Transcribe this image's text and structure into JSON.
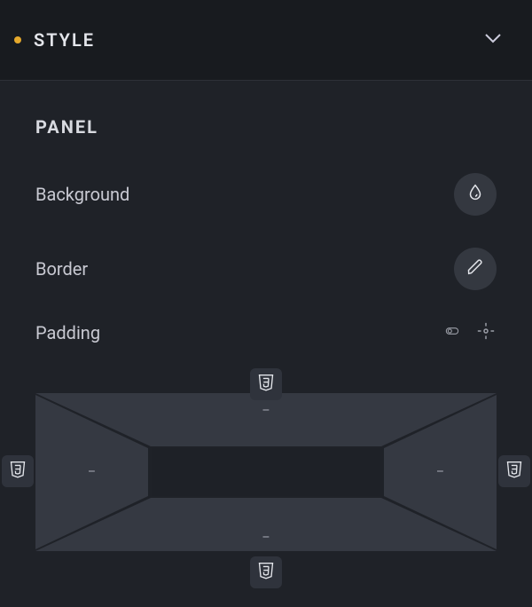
{
  "section": {
    "title": "STYLE",
    "modified": true
  },
  "panel": {
    "heading": "PANEL",
    "rows": {
      "background": {
        "label": "Background"
      },
      "border": {
        "label": "Border"
      },
      "padding": {
        "label": "Padding",
        "linked": false,
        "values": {
          "top": "–",
          "right": "–",
          "bottom": "–",
          "left": "–"
        }
      }
    }
  },
  "icons": {
    "css3_badge": "css3-shield-icon"
  }
}
